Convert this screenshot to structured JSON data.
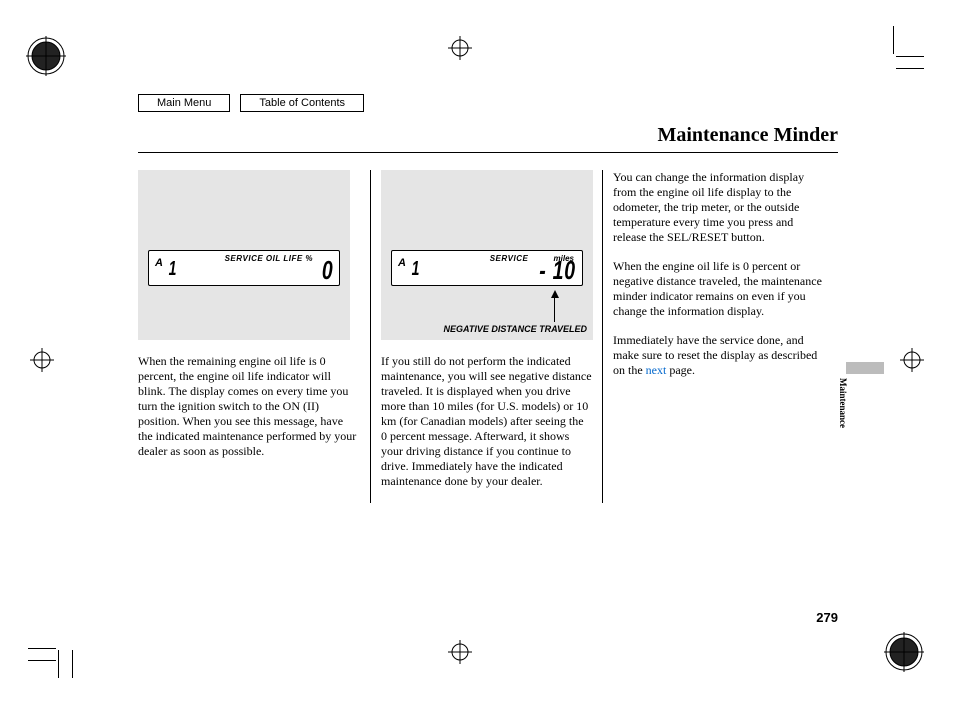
{
  "nav": {
    "main_menu": "Main Menu",
    "toc": "Table of Contents"
  },
  "title": "Maintenance Minder",
  "col1": {
    "lcd_prefix_letter": "A",
    "lcd_prefix_num": "1",
    "lcd_label": "SERVICE OIL LIFE %",
    "lcd_value": "0",
    "para1": "When the remaining engine oil life is 0 percent, the engine oil life indicator will blink. The display comes on every time you turn the ignition switch to the ON (II) position. When you see this message, have the indicated maintenance performed by your dealer as soon as possible."
  },
  "col2": {
    "lcd_prefix_letter": "A",
    "lcd_prefix_num": "1",
    "lcd_label": "SERVICE",
    "lcd_units": "miles",
    "lcd_value": "- 10",
    "caption": "NEGATIVE DISTANCE TRAVELED",
    "para1": "If you still do not perform the indicated maintenance, you will see negative distance traveled. It is displayed when you drive more than 10 miles (for U.S. models) or 10 km (for Canadian models) after seeing the 0 percent message. Afterward, it shows your driving distance if you continue to drive. Immediately have the indicated maintenance done by your dealer."
  },
  "col3": {
    "para1": "You can change the information display from the engine oil life display to the odometer, the trip meter, or the outside temperature every time you press and release the SEL/RESET button.",
    "para2": "When the engine oil life is 0 percent or negative distance traveled, the maintenance minder indicator remains on even if you change the information display.",
    "para3a": "Immediately have the service done, and make sure to reset the display as described on the ",
    "link": "next",
    "para3b": " page."
  },
  "side_tab": "Maintenance",
  "page_num": "279"
}
